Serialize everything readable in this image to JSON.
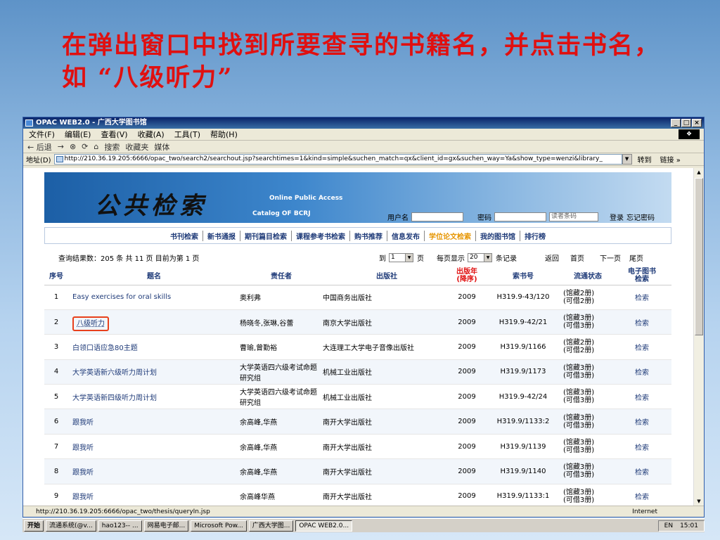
{
  "slide": {
    "title": "在弹出窗口中找到所要查寻的书籍名，并点击书名，如 “八级听力”"
  },
  "browser": {
    "title": "OPAC WEB2.0 - 广西大学图书馆",
    "menu": [
      "文件(F)",
      "编辑(E)",
      "查看(V)",
      "收藏(A)",
      "工具(T)",
      "帮助(H)"
    ],
    "toolbar": [
      "← 后退",
      "→",
      "⊗",
      "⟳",
      "⌂",
      "搜索",
      "收藏夹",
      "媒体"
    ],
    "address_label": "地址(D)",
    "address": "http://210.36.19.205:6666/opac_two/search2/searchout.jsp?searchtimes=1&kind=simple&suchen_match=qx&client_id=gx&suchen_way=Ya&show_type=wenzi&library_",
    "goto": "转到",
    "links": "链接 »",
    "status_url": "http://210.36.19.205:6666/opac_two/thesis/queryIn.jsp",
    "status_zone": "Internet"
  },
  "banner": {
    "logo": "公共检索",
    "en1": "Online Public Access",
    "en2": "Catalog OF BCRJ",
    "user_label": "用户名",
    "pwd_label": "密码",
    "type_option": "读者条码",
    "login": "登录",
    "forgot": "忘记密码"
  },
  "nav": {
    "items": [
      "书刊检索",
      "新书通报",
      "期刊篇目检索",
      "课程参考书检索",
      "购书推荐",
      "信息发布",
      "学位论文检索",
      "我的图书馆",
      "排行榜"
    ]
  },
  "info": {
    "summary": "查询结果数：205 条  共 11 页  目前为第 1 页",
    "goto_label": "到",
    "page_val": "1",
    "page_unit": "页",
    "perpage_label": "每页显示",
    "perpage_val": "20",
    "perpage_unit": "条记录",
    "back": "返回",
    "first": "首页",
    "next": "下一页",
    "last": "尾页"
  },
  "table": {
    "headers": {
      "idx": "序号",
      "title": "题名",
      "author": "责任者",
      "pub": "出版社",
      "year": "出版年\n(降序)",
      "call": "索书号",
      "status": "流通状态",
      "ebook": "电子图书\n检索"
    },
    "rows": [
      {
        "idx": "1",
        "title": "Easy exercises for oral skills",
        "author": "奥利弗",
        "pub": "中国商务出版社",
        "year": "2009",
        "call": "H319.9-43/120",
        "s1": "(馆藏2册)",
        "s2": "(可借2册)",
        "link": "检索"
      },
      {
        "idx": "2",
        "title": "八级听力",
        "author": "杨晓冬,张琳,谷蕾",
        "pub": "南京大学出版社",
        "year": "2009",
        "call": "H319.9-42/21",
        "s1": "(馆藏3册)",
        "s2": "(可借3册)",
        "link": "检索"
      },
      {
        "idx": "3",
        "title": "白领口语应急80主题",
        "author": "曹瑜,曾勤裕",
        "pub": "大连理工大学电子音像出版社",
        "year": "2009",
        "call": "H319.9/1166",
        "s1": "(馆藏2册)",
        "s2": "(可借2册)",
        "link": "检索"
      },
      {
        "idx": "4",
        "title": "大学英语新六级听力周计划",
        "author": "大学英语四六级考试命题研究组",
        "pub": "机械工业出版社",
        "year": "2009",
        "call": "H319.9/1173",
        "s1": "(馆藏3册)",
        "s2": "(可借3册)",
        "link": "检索"
      },
      {
        "idx": "5",
        "title": "大学英语新四级听力周计划",
        "author": "大学英语四六级考试命题研究组",
        "pub": "机械工业出版社",
        "year": "2009",
        "call": "H319.9-42/24",
        "s1": "(馆藏3册)",
        "s2": "(可借3册)",
        "link": "检索"
      },
      {
        "idx": "6",
        "title": "跟我听",
        "author": "余高峰,华燕",
        "pub": "南开大学出版社",
        "year": "2009",
        "call": "H319.9/1133:2",
        "s1": "(馆藏3册)",
        "s2": "(可借3册)",
        "link": "检索"
      },
      {
        "idx": "7",
        "title": "跟我听",
        "author": "余高峰,华燕",
        "pub": "南开大学出版社",
        "year": "2009",
        "call": "H319.9/1139",
        "s1": "(馆藏3册)",
        "s2": "(可借3册)",
        "link": "检索"
      },
      {
        "idx": "8",
        "title": "跟我听",
        "author": "余高峰,华燕",
        "pub": "南开大学出版社",
        "year": "2009",
        "call": "H319.9/1140",
        "s1": "(馆藏3册)",
        "s2": "(可借3册)",
        "link": "检索"
      },
      {
        "idx": "9",
        "title": "跟我听",
        "author": "余高峰华燕",
        "pub": "南开大学出版社",
        "year": "2009",
        "call": "H319.9/1133:1",
        "s1": "(馆藏3册)",
        "s2": "(可借3册)",
        "link": "检索"
      }
    ]
  },
  "taskbar": {
    "start": "开始",
    "items": [
      "流通系统(@v...",
      "hao123-- ...",
      "网易电子邮...",
      "Microsoft Pow...",
      "广西大学图...",
      "OPAC WEB2.0..."
    ],
    "clock": "15:01",
    "tray": "EN"
  }
}
